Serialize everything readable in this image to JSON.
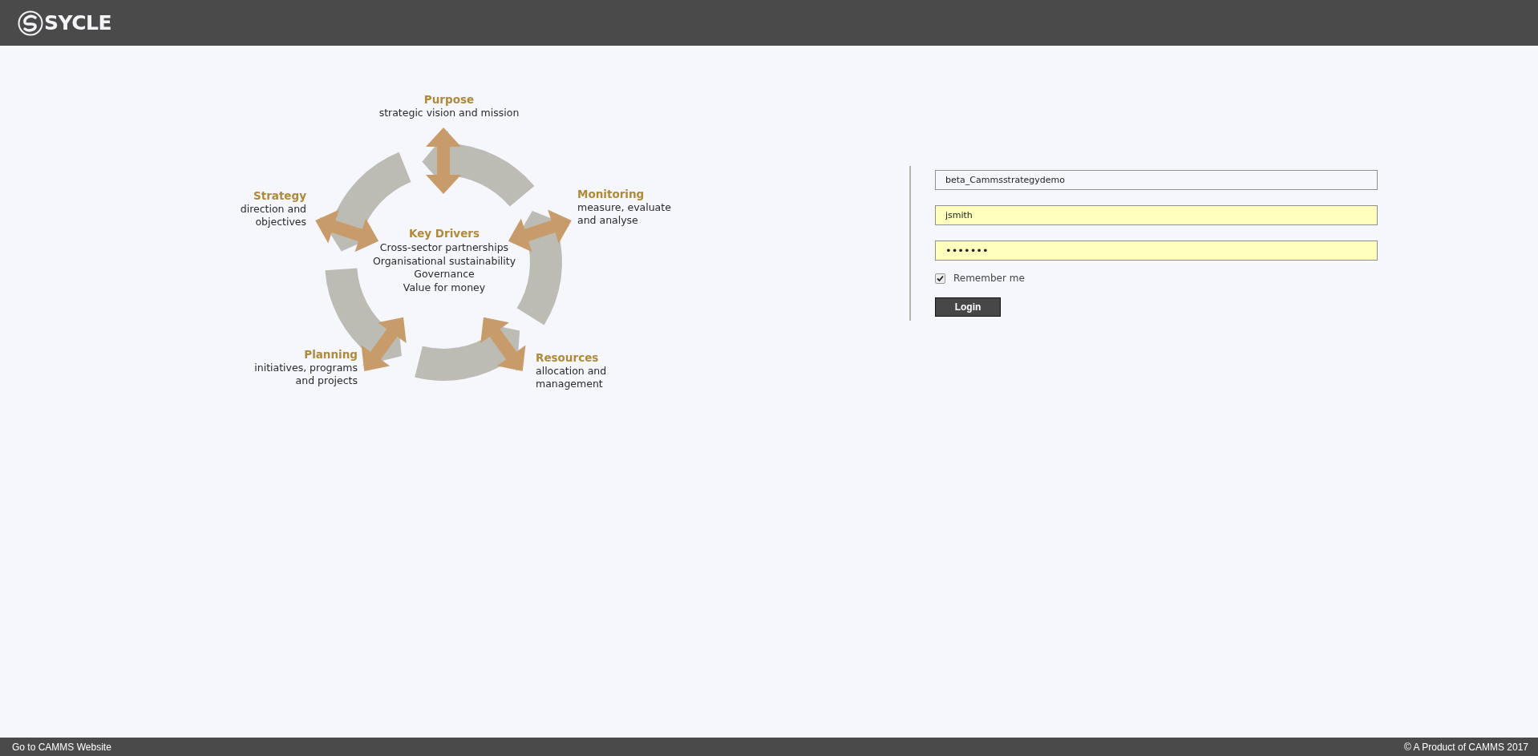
{
  "header": {
    "logo_text": "SYCLE"
  },
  "diagram": {
    "center": {
      "title": "Key Drivers",
      "lines": [
        "Cross-sector partnerships",
        "Organisational sustainability",
        "Governance",
        "Value for money"
      ]
    },
    "segments": [
      {
        "title": "Purpose",
        "lines": [
          "strategic vision and mission"
        ]
      },
      {
        "title": "Strategy",
        "lines": [
          "direction and",
          "objectives"
        ]
      },
      {
        "title": "Monitoring",
        "lines": [
          "measure, evaluate",
          "and analyse"
        ]
      },
      {
        "title": "Planning",
        "lines": [
          "initiatives, programs",
          "and projects"
        ]
      },
      {
        "title": "Resources",
        "lines": [
          "allocation and",
          "management"
        ]
      }
    ]
  },
  "login": {
    "fields": [
      {
        "kind": "text",
        "value": "beta_Cammsstrategydemo",
        "autofilled": false
      },
      {
        "kind": "text",
        "value": "jsmith",
        "autofilled": true
      },
      {
        "kind": "password",
        "value": "•••••••",
        "autofilled": true
      }
    ],
    "remember": {
      "label": "Remember me",
      "checked": true
    },
    "button": "Login"
  },
  "footer": {
    "link": "Go to CAMMS Website",
    "copyright": "© A Product of CAMMS 2017"
  }
}
